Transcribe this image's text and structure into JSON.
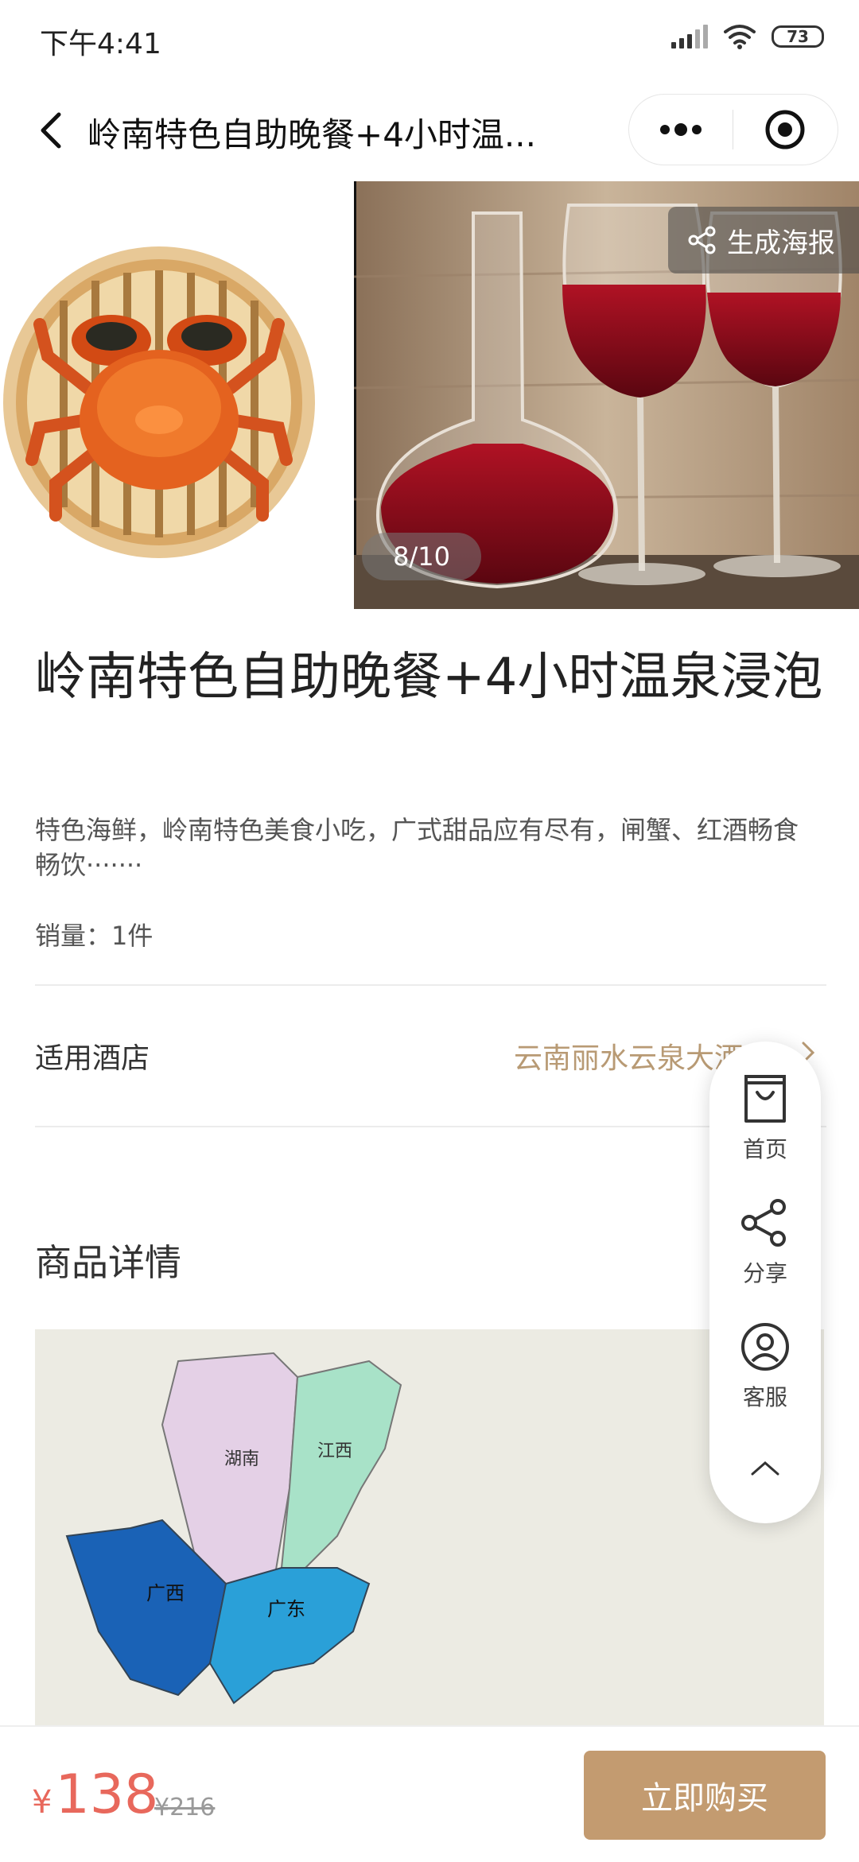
{
  "status_bar": {
    "time": "下午4:41",
    "battery": "73"
  },
  "nav": {
    "title": "岭南特色自助晚餐+4小时温..."
  },
  "gallery": {
    "poster_label": "生成海报",
    "counter": "8/10"
  },
  "product": {
    "title": "岭南特色自助晚餐+4小时温泉浸泡",
    "description": "特色海鲜，岭南特色美食小吃，广式甜品应有尽有，闸蟹、红酒畅食畅饮·······",
    "sales": "销量：1件"
  },
  "hotel": {
    "label": "适用酒店",
    "value": "云南丽水云泉大酒店"
  },
  "detail": {
    "heading": "商品详情",
    "map_labels": {
      "hunan": "湖南",
      "jiangxi": "江西",
      "guangxi": "广西",
      "guangdong": "广东"
    }
  },
  "float_menu": {
    "home": "首页",
    "share": "分享",
    "service": "客服"
  },
  "bottom": {
    "currency": "¥",
    "price": "138",
    "original_price": "¥216",
    "buy_label": "立即购买"
  },
  "colors": {
    "accent": "#c39b70",
    "price": "#e8685c",
    "hotel_link": "#b89a74"
  }
}
